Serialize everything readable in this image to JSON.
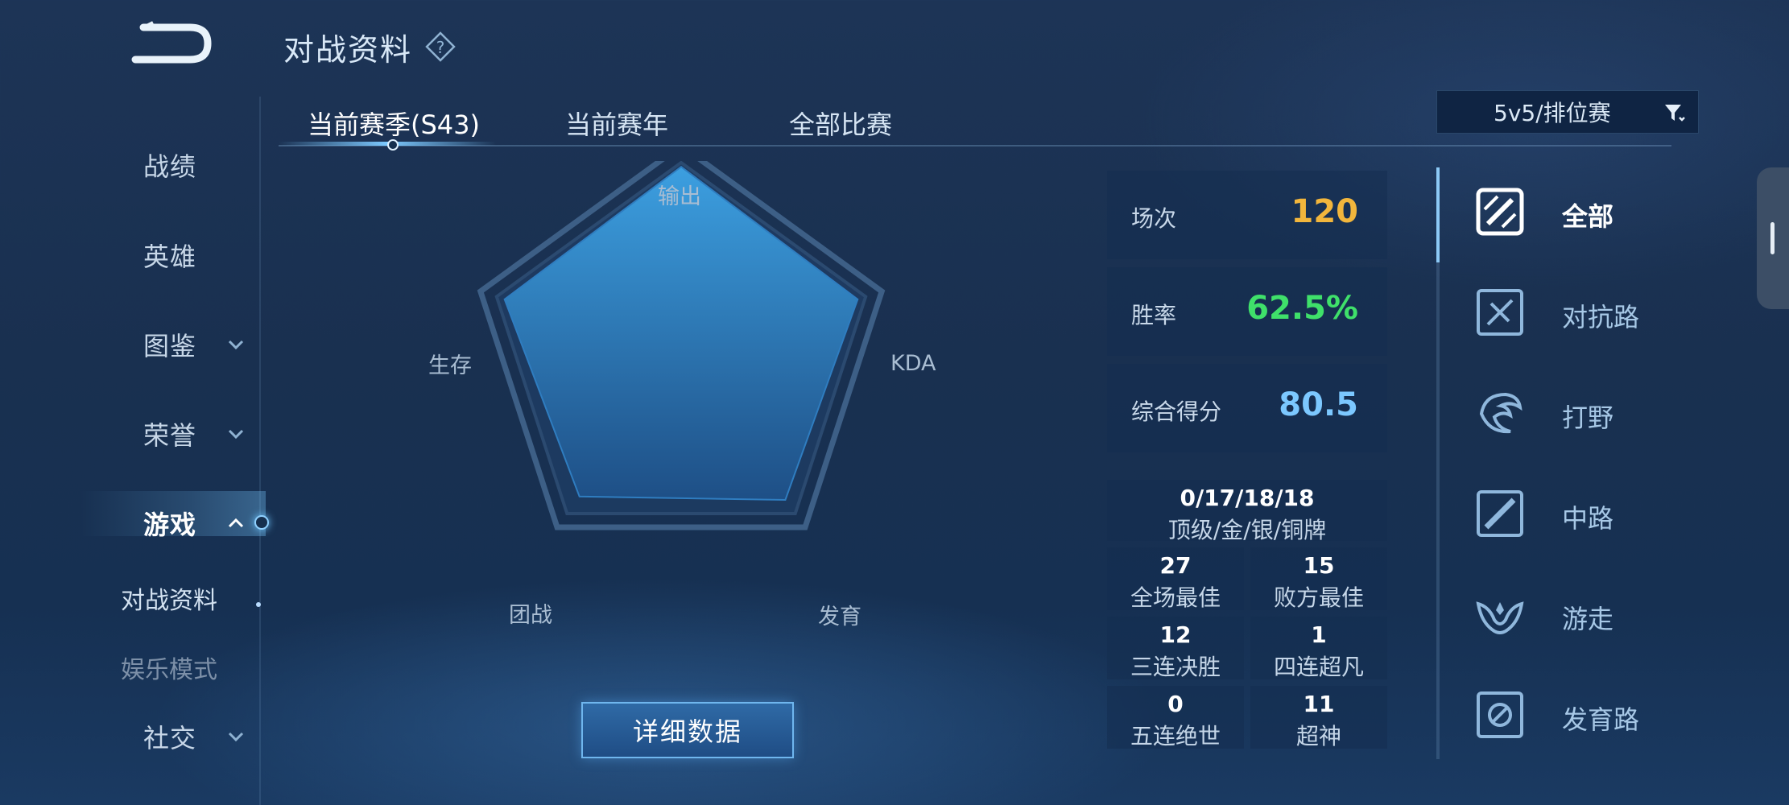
{
  "header": {
    "title": "对战资料"
  },
  "sidebar": {
    "items": [
      {
        "label": "战绩",
        "chevron": ""
      },
      {
        "label": "英雄",
        "chevron": ""
      },
      {
        "label": "图鉴",
        "chevron": "down"
      },
      {
        "label": "荣誉",
        "chevron": "down"
      },
      {
        "label": "游戏",
        "chevron": "up",
        "active": true
      },
      {
        "label": "社交",
        "chevron": "down"
      }
    ],
    "subitems": [
      {
        "label": "对战资料",
        "active": true
      },
      {
        "label": "娱乐模式",
        "active": false
      }
    ]
  },
  "tabs": [
    {
      "label": "当前赛季(S43)",
      "active": true
    },
    {
      "label": "当前赛年",
      "active": false
    },
    {
      "label": "全部比赛",
      "active": false
    }
  ],
  "mode_filter": {
    "label": "5v5/排位赛"
  },
  "radar": {
    "axes": [
      "输出",
      "KDA",
      "发育",
      "团战",
      "生存"
    ],
    "values": [
      0.9,
      0.88,
      0.84,
      0.82,
      0.88
    ]
  },
  "detail_button": {
    "label": "详细数据"
  },
  "stats": [
    {
      "label": "场次",
      "value": "120",
      "color": "#f2b63c"
    },
    {
      "label": "胜率",
      "value": "62.5%",
      "color": "#3fe06a"
    },
    {
      "label": "综合得分",
      "value": "80.5",
      "color": "#7cc8ff"
    }
  ],
  "medals": {
    "top": {
      "value": "0/17/18/18",
      "label": "顶级/金/银/铜牌"
    },
    "cells": [
      {
        "value": "27",
        "label": "全场最佳"
      },
      {
        "value": "15",
        "label": "败方最佳"
      },
      {
        "value": "12",
        "label": "三连决胜"
      },
      {
        "value": "1",
        "label": "四连超凡"
      },
      {
        "value": "0",
        "label": "五连绝世"
      },
      {
        "value": "11",
        "label": "超神"
      }
    ]
  },
  "lanes": [
    {
      "label": "全部",
      "icon": "all-lanes-icon",
      "active": true
    },
    {
      "label": "对抗路",
      "icon": "clash-lane-icon",
      "active": false
    },
    {
      "label": "打野",
      "icon": "jungle-icon",
      "active": false
    },
    {
      "label": "中路",
      "icon": "mid-lane-icon",
      "active": false
    },
    {
      "label": "游走",
      "icon": "roam-icon",
      "active": false
    },
    {
      "label": "发育路",
      "icon": "farm-lane-icon",
      "active": false
    }
  ],
  "colors": {
    "accent": "#7cc9ff",
    "background": "#193050"
  }
}
